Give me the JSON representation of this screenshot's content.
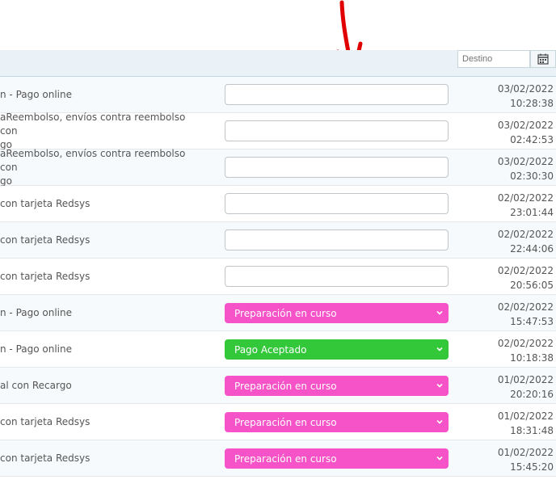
{
  "filters": {
    "destino_placeholder": "Destino"
  },
  "colors": {
    "preparacion": "#f553c7",
    "aceptado": "#33c73a",
    "annotation_arrow": "#e00000"
  },
  "rows": [
    {
      "payment": "n - Pago online",
      "status": "",
      "date": "03/02/2022",
      "time": "10:28:38"
    },
    {
      "payment": "aReembolso, envíos contra reembolso con\ngo",
      "status": "",
      "date": "03/02/2022",
      "time": "02:42:53"
    },
    {
      "payment": "aReembolso, envíos contra reembolso con\ngo",
      "status": "",
      "date": "03/02/2022",
      "time": "02:30:30"
    },
    {
      "payment": " con tarjeta Redsys",
      "status": "",
      "date": "02/02/2022",
      "time": "23:01:44"
    },
    {
      "payment": " con tarjeta Redsys",
      "status": "",
      "date": "02/02/2022",
      "time": "22:44:06"
    },
    {
      "payment": " con tarjeta Redsys",
      "status": "",
      "date": "02/02/2022",
      "time": "20:56:05"
    },
    {
      "payment": "n - Pago online",
      "status": "Preparación en curso",
      "date": "02/02/2022",
      "time": "15:47:53"
    },
    {
      "payment": "n - Pago online",
      "status": "Pago Aceptado",
      "date": "02/02/2022",
      "time": "10:18:38"
    },
    {
      "payment": "al con Recargo",
      "status": "Preparación en curso",
      "date": "01/02/2022",
      "time": "20:20:16"
    },
    {
      "payment": " con tarjeta Redsys",
      "status": "Preparación en curso",
      "date": "01/02/2022",
      "time": "18:31:48"
    },
    {
      "payment": " con tarjeta Redsys",
      "status": "Preparación en curso",
      "date": "01/02/2022",
      "time": "15:45:20"
    }
  ]
}
